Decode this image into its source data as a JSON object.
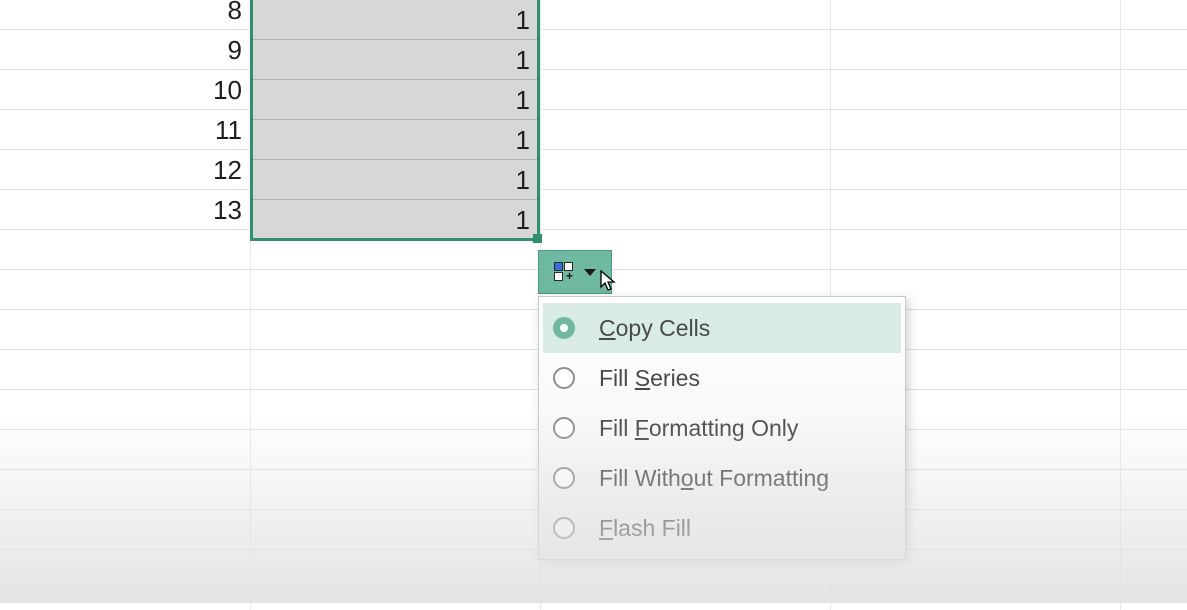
{
  "grid": {
    "rows": [
      {
        "a": "8",
        "b": "1"
      },
      {
        "a": "9",
        "b": "1"
      },
      {
        "a": "10",
        "b": "1"
      },
      {
        "a": "11",
        "b": "1"
      },
      {
        "a": "12",
        "b": "1"
      },
      {
        "a": "13",
        "b": "1"
      }
    ]
  },
  "autofill_button": {
    "icon": "autofill-options-icon",
    "caret": "dropdown-caret-icon"
  },
  "menu": {
    "items": [
      {
        "label_pre": "",
        "mnemonic": "C",
        "label_post": "opy Cells",
        "selected": true
      },
      {
        "label_pre": "Fill ",
        "mnemonic": "S",
        "label_post": "eries",
        "selected": false
      },
      {
        "label_pre": "Fill ",
        "mnemonic": "F",
        "label_post": "ormatting Only",
        "selected": false
      },
      {
        "label_pre": "Fill With",
        "mnemonic": "o",
        "label_post": "ut Formatting",
        "selected": false
      },
      {
        "label_pre": "",
        "mnemonic": "F",
        "label_post": "lash Fill",
        "selected": false
      }
    ]
  }
}
